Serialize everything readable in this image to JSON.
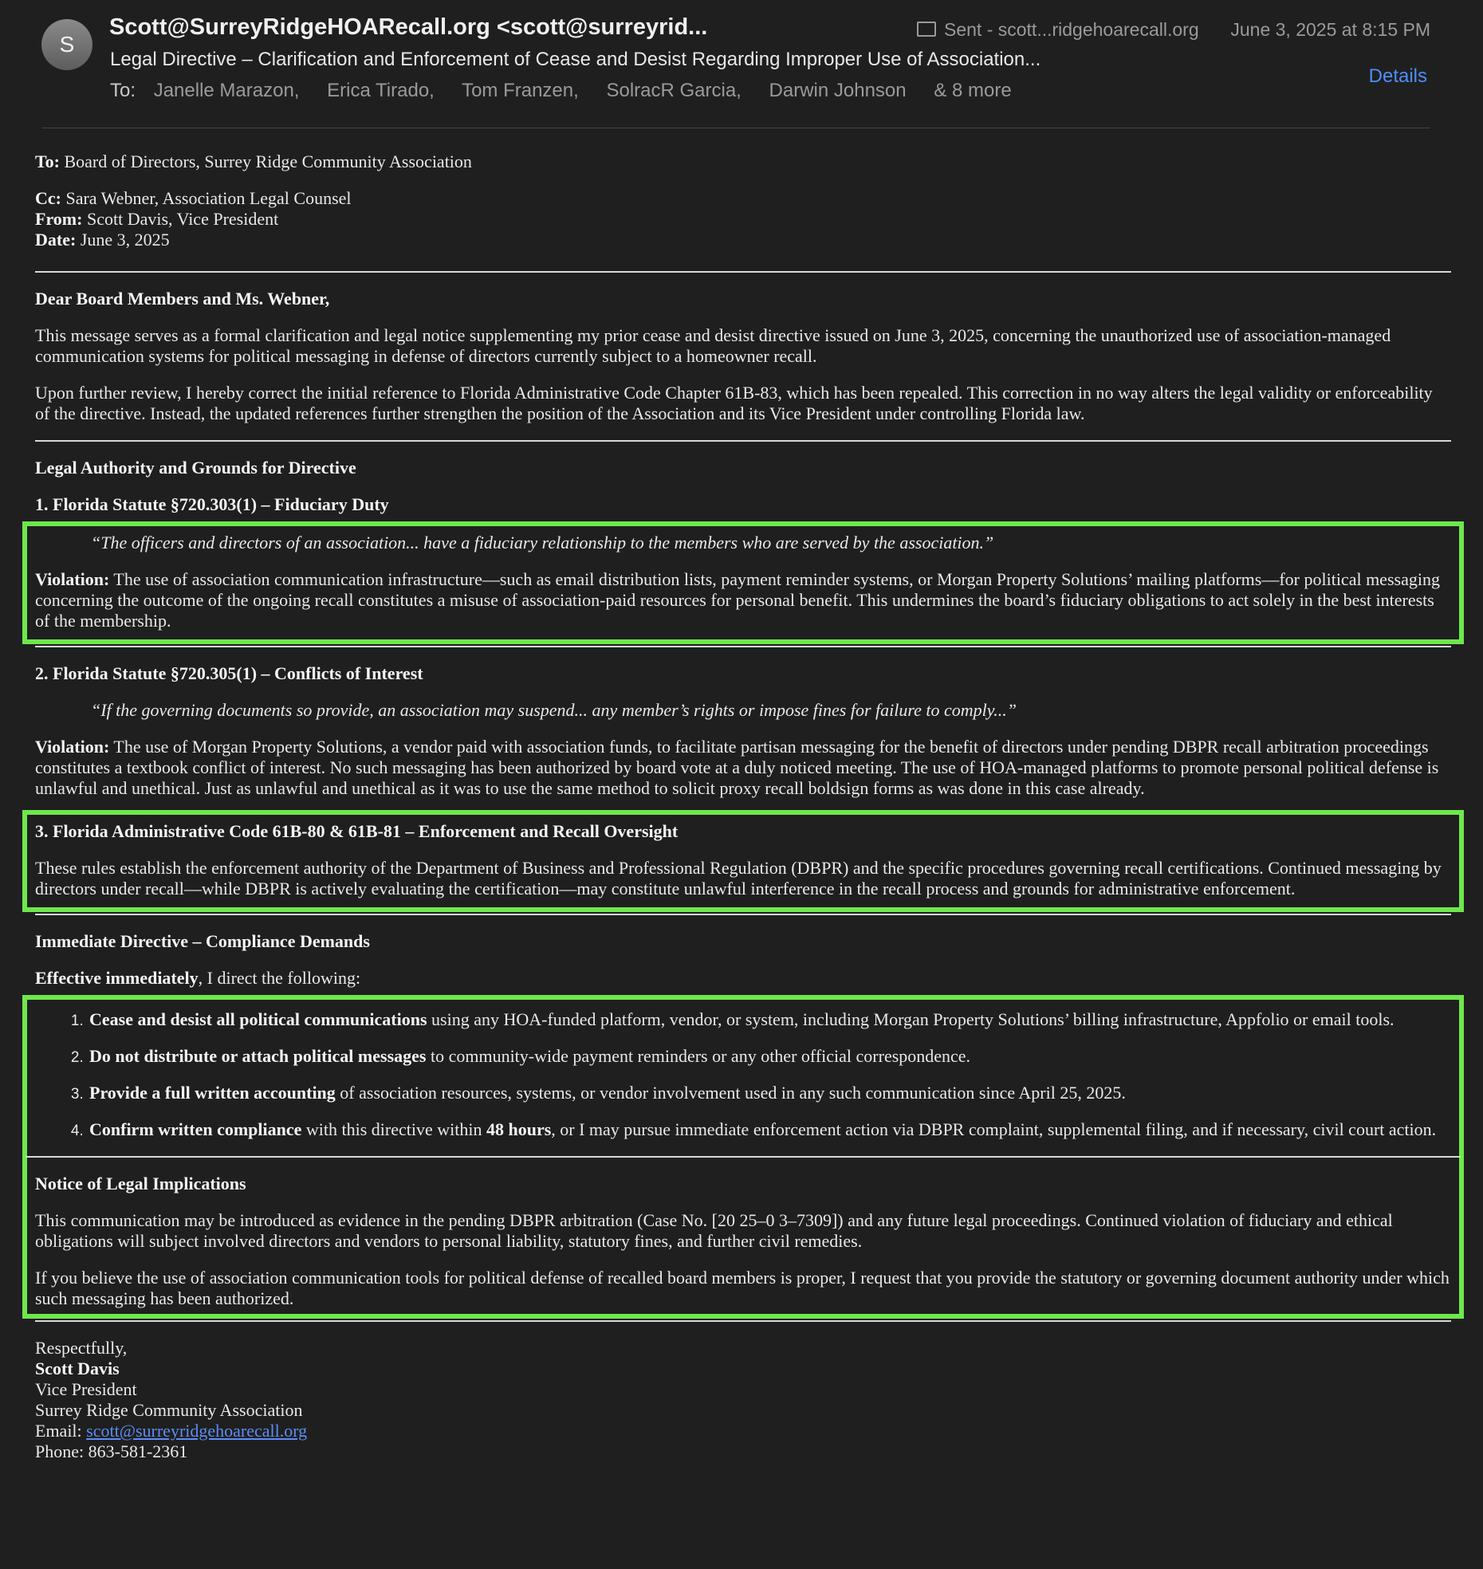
{
  "header": {
    "avatar_letter": "S",
    "sender": "Scott@SurreyRidgeHOARecall.org <scott@surreyrid...",
    "mailbox": "Sent - scott...ridgehoarecall.org",
    "date": "June 3, 2025 at 8:15 PM",
    "subject": "Legal Directive – Clarification and Enforcement of Cease and Desist Regarding Improper Use of Association...",
    "to_label": "To:",
    "recipients": [
      "Janelle Marazon,",
      "Erica Tirado,",
      "Tom Franzen,",
      "SolracR Garcia,",
      "Darwin Johnson"
    ],
    "more": "& 8 more",
    "details_label": "Details",
    "mailbox_icon": "folder-icon"
  },
  "memo": {
    "to_label": "To:",
    "to_value": " Board of Directors, Surrey Ridge Community Association",
    "cc_label": "Cc:",
    "cc_value": " Sara Webner, Association Legal Counsel",
    "from_label": "From:",
    "from_value": " Scott Davis, Vice President",
    "date_label": "Date:",
    "date_value": " June 3, 2025"
  },
  "letter": {
    "salutation": "Dear Board Members and Ms. Webner,",
    "intro_p1": "This message serves as a formal clarification and legal notice supplementing my prior cease and desist directive issued on  June 3, 2025, concerning the unauthorized use of association-managed communication systems for political messaging in defense of directors currently subject to a homeowner recall.",
    "intro_p2": "Upon further review, I hereby correct the initial reference to Florida Administrative Code Chapter 61B-83, which has been repealed. This correction in no way alters the legal validity or enforceability of the directive. Instead, the updated references further strengthen the position of the Association and its Vice President under controlling Florida law.",
    "authority_heading": "Legal Authority and Grounds for Directive",
    "s1_heading": "1. Florida Statute §720.303(1) – Fiduciary Duty",
    "s1_quote": "“The officers and directors of an association... have a fiduciary relationship to the members who are served by the association.”",
    "violation_label": "Violation:",
    "s1_violation": " The use of association communication infrastructure—such as email distribution lists, payment reminder systems, or Morgan Property Solutions’ mailing platforms—for political messaging concerning the outcome of the ongoing recall constitutes a misuse of association-paid resources for personal benefit. This undermines the board’s fiduciary obligations to act solely in the best interests of the membership.",
    "s2_heading": "2. Florida Statute §720.305(1) – Conflicts of Interest",
    "s2_quote": "“If the governing documents so provide, an association may suspend... any member’s rights or impose fines for failure to comply...”",
    "s2_violation": " The use of Morgan Property Solutions, a vendor paid with association funds, to facilitate partisan messaging for the benefit of directors under pending DBPR recall arbitration proceedings constitutes a textbook conflict of interest. No such messaging has been authorized by board vote at a duly noticed meeting. The use of HOA-managed platforms to promote personal political defense is unlawful and unethical. Just as unlawful and unethical as it was to use the same method to solicit proxy recall boldsign forms as was done in this case already.",
    "s3_heading": "3. Florida Administrative Code 61B-80 & 61B-81 – Enforcement and Recall Oversight",
    "s3_body": "These rules establish the enforcement authority of the Department of Business and Professional Regulation (DBPR) and the specific procedures governing recall certifications. Continued messaging by directors under recall—while DBPR is actively evaluating the certification—may constitute unlawful interference in the recall process and grounds for administrative enforcement.",
    "directive_heading": "Immediate Directive – Compliance Demands",
    "effective_bold": "Effective immediately",
    "effective_rest": ", I direct the following:",
    "items": [
      {
        "bold": "Cease and desist all political communications",
        "rest": " using any HOA-funded platform, vendor, or system, including Morgan Property Solutions’ billing infrastructure, Appfolio or email tools."
      },
      {
        "bold": "Do not distribute or attach political messages",
        "rest": " to community-wide payment reminders or any other official correspondence."
      },
      {
        "bold": "Provide a full written accounting",
        "rest": " of association resources, systems, or vendor involvement used in any such communication since April 25, 2025."
      },
      {
        "bold": "Confirm written compliance",
        "mid": " with this directive within ",
        "bold2": "48 hours",
        "rest": ", or I may pursue immediate enforcement action via DBPR complaint, supplemental filing, and if necessary, civil court action."
      }
    ],
    "notice_heading": "Notice of Legal Implications",
    "notice_p1": "This communication may be introduced as evidence in the pending DBPR arbitration (Case No. [20 25–0 3–7309]) and any future legal proceedings. Continued violation of fiduciary and ethical obligations will subject involved directors and vendors to personal liability, statutory fines, and further civil remedies.",
    "notice_p2": "If you believe the use of association communication tools for political defense of recalled board members is proper, I request that you provide the statutory or governing document authority under which such messaging has been authorized."
  },
  "signature": {
    "closing": "Respectfully,",
    "name": "Scott Davis",
    "title": "Vice President",
    "org": "Surrey Ridge Community Association",
    "email_label": "Email: ",
    "email": "scott@surreyridgehoarecall.org",
    "phone_label": "Phone: ",
    "phone": "863-581-2361"
  },
  "colors": {
    "highlight_box": "#6ee74c",
    "link": "#5b8df5",
    "background": "#1f1f1f"
  }
}
